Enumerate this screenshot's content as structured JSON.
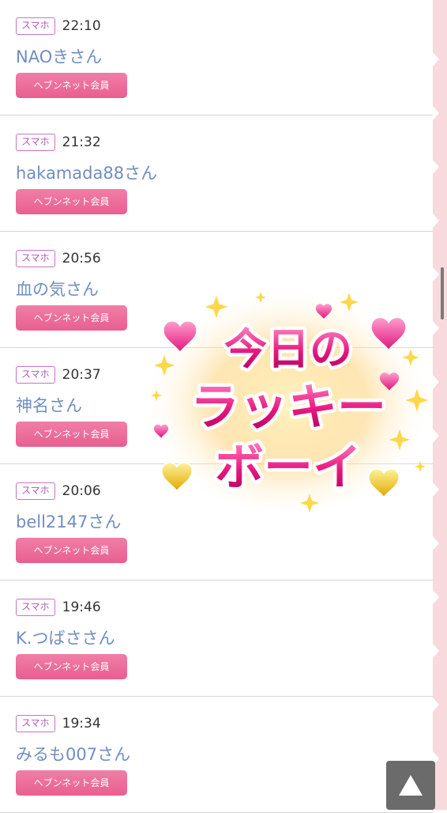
{
  "entries": [
    {
      "device": "スマホ",
      "time": "22:10",
      "name": "NAOきさん",
      "badge": "ヘブンネット会員"
    },
    {
      "device": "スマホ",
      "time": "21:32",
      "name": "hakamada88さん",
      "badge": "ヘブンネット会員"
    },
    {
      "device": "スマホ",
      "time": "20:56",
      "name": "血の気さん",
      "badge": "ヘブンネット会員"
    },
    {
      "device": "スマホ",
      "time": "20:37",
      "name": "神名さん",
      "badge": "ヘブンネット会員"
    },
    {
      "device": "スマホ",
      "time": "20:06",
      "name": "bell2147さん",
      "badge": "ヘブンネット会員"
    },
    {
      "device": "スマホ",
      "time": "19:46",
      "name": "K.つばささん",
      "badge": "ヘブンネット会員"
    },
    {
      "device": "スマホ",
      "time": "19:34",
      "name": "みるも007さん",
      "badge": "ヘブンネット会員"
    }
  ],
  "stamp": {
    "line1": "今日の",
    "line2": "ラッキー",
    "line3": "ボーイ"
  },
  "page_top_button": {
    "icon": "triangle-up-icon"
  },
  "colors": {
    "name_link": "#6f8ec2",
    "member_badge": "#e8689a",
    "device_badge_border": "#c873c8",
    "side_strip": "#f7d9de",
    "top_button": "#6b6b6b"
  }
}
